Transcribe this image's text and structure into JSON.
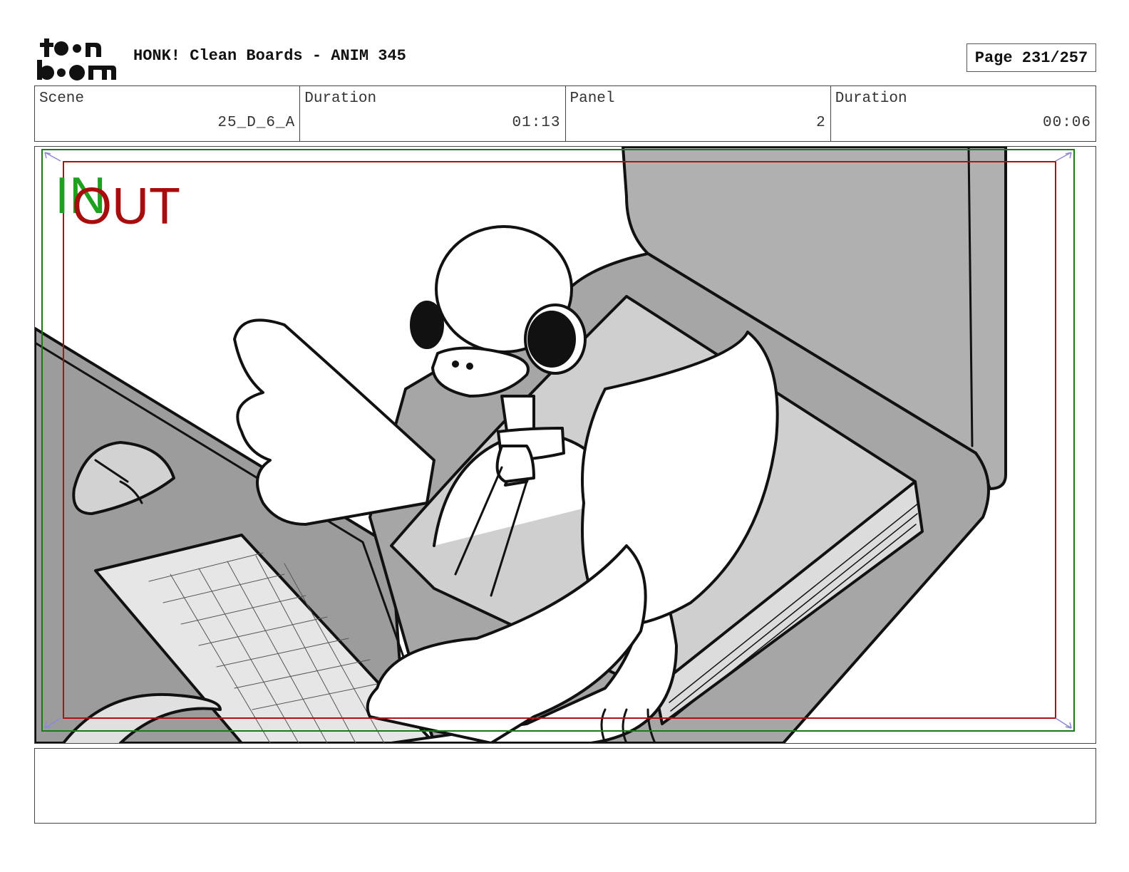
{
  "header": {
    "logo_text": "toon boom",
    "title": "HONK! Clean Boards - ANIM 345",
    "page_label": "Page 231/257"
  },
  "info": [
    {
      "label": "Scene",
      "value": "25_D_6_A"
    },
    {
      "label": "Duration",
      "value": "01:13"
    },
    {
      "label": "Panel",
      "value": "2"
    },
    {
      "label": "Duration",
      "value": "00:06"
    }
  ],
  "panel": {
    "in_marker": "IN",
    "out_marker": "OUT",
    "colors": {
      "in_frame": "#1a7a1a",
      "out_frame": "#b01010",
      "in_text": "#1fa01f",
      "out_text": "#a80c0c"
    }
  },
  "notes": {
    "text": ""
  }
}
